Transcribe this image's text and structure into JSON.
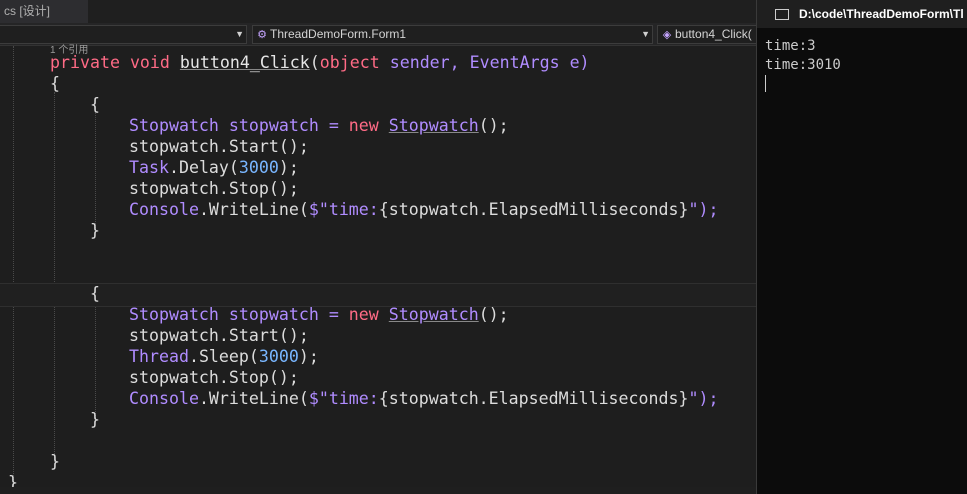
{
  "editor": {
    "tab_label": "cs [设计]",
    "nav": {
      "project": "",
      "class": "ThreadDemoForm.Form1",
      "member": "button4_Click("
    },
    "references_hint": "1 个引用",
    "method_signature": {
      "k1": "private",
      "k2": "void",
      "name": "button4_Click",
      "p1": "(",
      "type1": "object",
      "arg1": " sender, ",
      "type2": "EventArgs",
      "arg2": " e)"
    },
    "block1": {
      "sw_type": "Stopwatch",
      "sw_var": " stopwatch = ",
      "new_kw": "new",
      "sw_ctor": "Stopwatch",
      "sw_end": "();",
      "start": "stopwatch.Start();",
      "wait_class": "Task",
      "wait_method": ".Delay(",
      "wait_value": "3000",
      "wait_end": ");",
      "stop": "stopwatch.Stop();",
      "console_class": "Console",
      "writeline": ".WriteLine(",
      "str_open": "$\"time:",
      "interp": "{stopwatch.ElapsedMilliseconds}",
      "str_close": "\");"
    },
    "block2": {
      "sw_type": "Stopwatch",
      "sw_var": " stopwatch = ",
      "new_kw": "new",
      "sw_ctor": "Stopwatch",
      "sw_end": "();",
      "start": "stopwatch.Start();",
      "wait_class": "Thread",
      "wait_method": ".Sleep(",
      "wait_value": "3000",
      "wait_end": ");",
      "stop": "stopwatch.Stop();",
      "console_class": "Console",
      "writeline": ".WriteLine(",
      "str_open": "$\"time:",
      "interp": "{stopwatch.ElapsedMilliseconds}",
      "str_close": "\");"
    },
    "braces": {
      "open": "{",
      "close": "}"
    }
  },
  "console": {
    "title": "D:\\code\\ThreadDemoForm\\Tl",
    "lines": [
      "time:3",
      "time:3010"
    ]
  },
  "colors": {
    "keyword": "#ff6b86",
    "type": "#b08cff",
    "number": "#79b6ff",
    "text": "#e6e6e6"
  }
}
